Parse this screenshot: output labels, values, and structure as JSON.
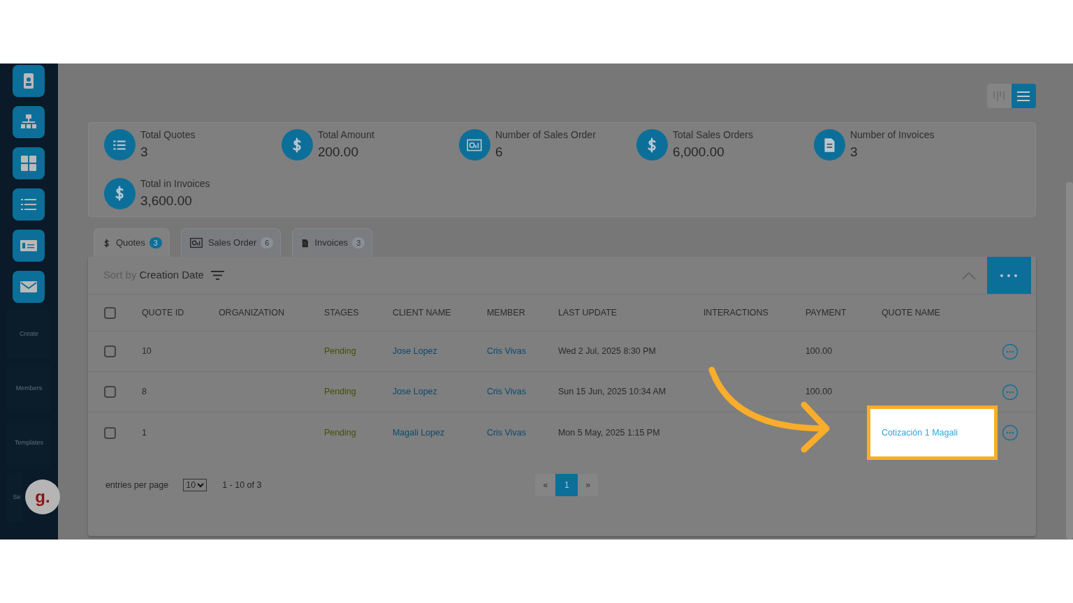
{
  "sidebar": {
    "items": [
      {
        "label": "Create"
      },
      {
        "label": "Members"
      },
      {
        "label": "Templates"
      },
      {
        "label": "Se"
      }
    ]
  },
  "view_toggle": [
    {
      "kind": "columns",
      "selected": false
    },
    {
      "kind": "list",
      "selected": true
    }
  ],
  "stats": [
    {
      "kind": "list",
      "label": "Total Quotes",
      "value": "3"
    },
    {
      "kind": "dollar",
      "label": "Total Amount",
      "value": "200.00"
    },
    {
      "kind": "chart",
      "label": "Number of Sales Order",
      "value": "6"
    },
    {
      "kind": "dollar",
      "label": "Total Sales Orders",
      "value": "6,000.00"
    },
    {
      "kind": "document",
      "label": "Number of Invoices",
      "value": "3"
    },
    {
      "kind": "dollar",
      "label": "Total in Invoices",
      "value": "3,600.00"
    }
  ],
  "tabs": [
    {
      "kind": "dollar",
      "label": "Quotes",
      "count": "3",
      "selected": true
    },
    {
      "kind": "chart",
      "label": "Sales Order",
      "count": "6",
      "selected": false
    },
    {
      "kind": "document",
      "label": "Invoices",
      "count": "3",
      "selected": false
    }
  ],
  "sort": {
    "prefix": "Sort by",
    "value": "Creation Date"
  },
  "table": {
    "select_all": {
      "checked": false
    },
    "columns": [
      "QUOTE ID",
      "ORGANIZATION",
      "STAGES",
      "CLIENT NAME",
      "MEMBER",
      "LAST UPDATE",
      "INTERACTIONS",
      "PAYMENT",
      "QUOTE NAME"
    ],
    "rows": [
      {
        "checked": false,
        "quote_id": "10",
        "stage": "Pending",
        "client": "Jose Lopez",
        "member": "Cris Vivas",
        "last_update": "Wed 2 Jul, 2025 8:30 PM",
        "payment": "100.00"
      },
      {
        "checked": false,
        "quote_id": "8",
        "stage": "Pending",
        "client": "Jose Lopez",
        "member": "Cris Vivas",
        "last_update": "Sun 15 Jun, 2025 10:34 AM",
        "payment": "100.00"
      },
      {
        "checked": false,
        "quote_id": "1",
        "stage": "Pending",
        "client": "Magali Lopez",
        "member": "Cris Vivas",
        "last_update": "Mon 5 May, 2025 1:15 PM",
        "quote_name": "Cotización 1 Magali",
        "highlighted": true
      }
    ]
  },
  "footer": {
    "entries_label": "entries per page",
    "per_page": "10",
    "range": "1 - 10 of 3",
    "prev": "«",
    "pages": [
      {
        "label": "1",
        "selected": true
      }
    ],
    "next": "»"
  },
  "avatar": {
    "letter": "g."
  }
}
